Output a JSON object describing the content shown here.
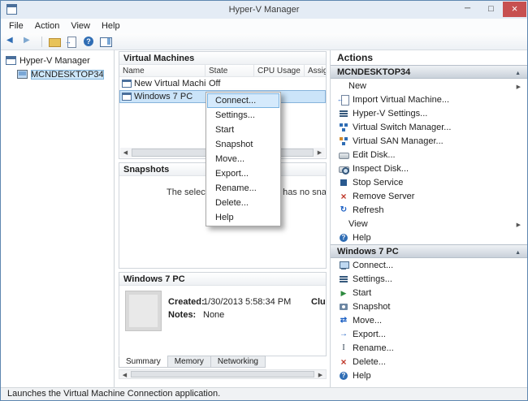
{
  "window": {
    "title": "Hyper-V Manager",
    "controls": [
      "minimize-button",
      "maximize-button",
      "close-button"
    ]
  },
  "menu_bar": {
    "items": [
      "File",
      "Action",
      "View",
      "Help"
    ]
  },
  "toolbar": {
    "icons": [
      "back-icon",
      "forward-icon",
      "show-console-tree-icon",
      "export-list-icon",
      "help-icon",
      "show-action-pane-icon"
    ]
  },
  "tree": {
    "root": "Hyper-V Manager",
    "server": "MCNDESKTOP34"
  },
  "vm_section": {
    "title": "Virtual Machines",
    "columns": [
      "Name",
      "State",
      "CPU Usage",
      "Assign"
    ],
    "rows": [
      {
        "name": "New Virtual Machine",
        "state": "Off",
        "cpu_usage": "",
        "assigned": "",
        "selected": false
      },
      {
        "name": "Windows 7 PC",
        "state": "",
        "cpu_usage": "",
        "assigned": "",
        "selected": true
      }
    ]
  },
  "snapshots_section": {
    "title": "Snapshots",
    "empty_message": "The selected virtual machine has no snapshots."
  },
  "details_section": {
    "title": "Windows 7 PC",
    "created": {
      "label": "Created:",
      "value": "1/30/2013 5:58:34 PM"
    },
    "notes": {
      "label": "Notes:",
      "value": "None"
    },
    "clipped_label": "Clust",
    "tabs": [
      {
        "label": "Summary",
        "active": true
      },
      {
        "label": "Memory",
        "active": false
      },
      {
        "label": "Networking",
        "active": false
      }
    ]
  },
  "context_menu": {
    "highlighted_item": "Connect...",
    "items": [
      {
        "label": "Connect..."
      },
      {
        "label": "Settings..."
      },
      {
        "label": "Start"
      },
      {
        "label": "Snapshot"
      },
      {
        "label": "Move..."
      },
      {
        "label": "Export..."
      },
      {
        "label": "Rename..."
      },
      {
        "label": "Delete..."
      },
      {
        "label": "Help"
      }
    ]
  },
  "actions_panel": {
    "title": "Actions",
    "groups": [
      {
        "title": "MCNDESKTOP34",
        "items": [
          {
            "label": "New",
            "icon": "",
            "submenu": true
          },
          {
            "label": "Import Virtual Machine...",
            "icon": "import-icon",
            "submenu": false
          },
          {
            "label": "Hyper-V Settings...",
            "icon": "settings-icon",
            "submenu": false
          },
          {
            "label": "Virtual Switch Manager...",
            "icon": "switch-manager-icon",
            "submenu": false
          },
          {
            "label": "Virtual SAN Manager...",
            "icon": "san-manager-icon",
            "submenu": false
          },
          {
            "label": "Edit Disk...",
            "icon": "edit-disk-icon",
            "submenu": false
          },
          {
            "label": "Inspect Disk...",
            "icon": "inspect-disk-icon",
            "submenu": false
          },
          {
            "label": "Stop Service",
            "icon": "stop-service-icon",
            "submenu": false
          },
          {
            "label": "Remove Server",
            "icon": "remove-server-icon",
            "submenu": false
          },
          {
            "label": "Refresh",
            "icon": "refresh-icon",
            "submenu": false
          },
          {
            "label": "View",
            "icon": "",
            "submenu": true
          },
          {
            "label": "Help",
            "icon": "help-icon",
            "submenu": false
          }
        ]
      },
      {
        "title": "Windows 7 PC",
        "items": [
          {
            "label": "Connect...",
            "icon": "connect-icon",
            "submenu": false
          },
          {
            "label": "Settings...",
            "icon": "settings-icon",
            "submenu": false
          },
          {
            "label": "Start",
            "icon": "start-icon",
            "submenu": false
          },
          {
            "label": "Snapshot",
            "icon": "snapshot-icon",
            "submenu": false
          },
          {
            "label": "Move...",
            "icon": "move-icon",
            "submenu": false
          },
          {
            "label": "Export...",
            "icon": "export-icon",
            "submenu": false
          },
          {
            "label": "Rename...",
            "icon": "rename-icon",
            "submenu": false
          },
          {
            "label": "Delete...",
            "icon": "delete-icon",
            "submenu": false
          },
          {
            "label": "Help",
            "icon": "help-icon",
            "submenu": false
          }
        ]
      }
    ]
  },
  "status_bar": {
    "text": "Launches the Virtual Machine Connection application."
  },
  "colors": {
    "selection": "#cbe4f9",
    "selection_border": "#86b3db",
    "menu_highlight": "#d5eafc",
    "accent_blue": "#2f6db4",
    "close_button_red": "#c75050"
  }
}
